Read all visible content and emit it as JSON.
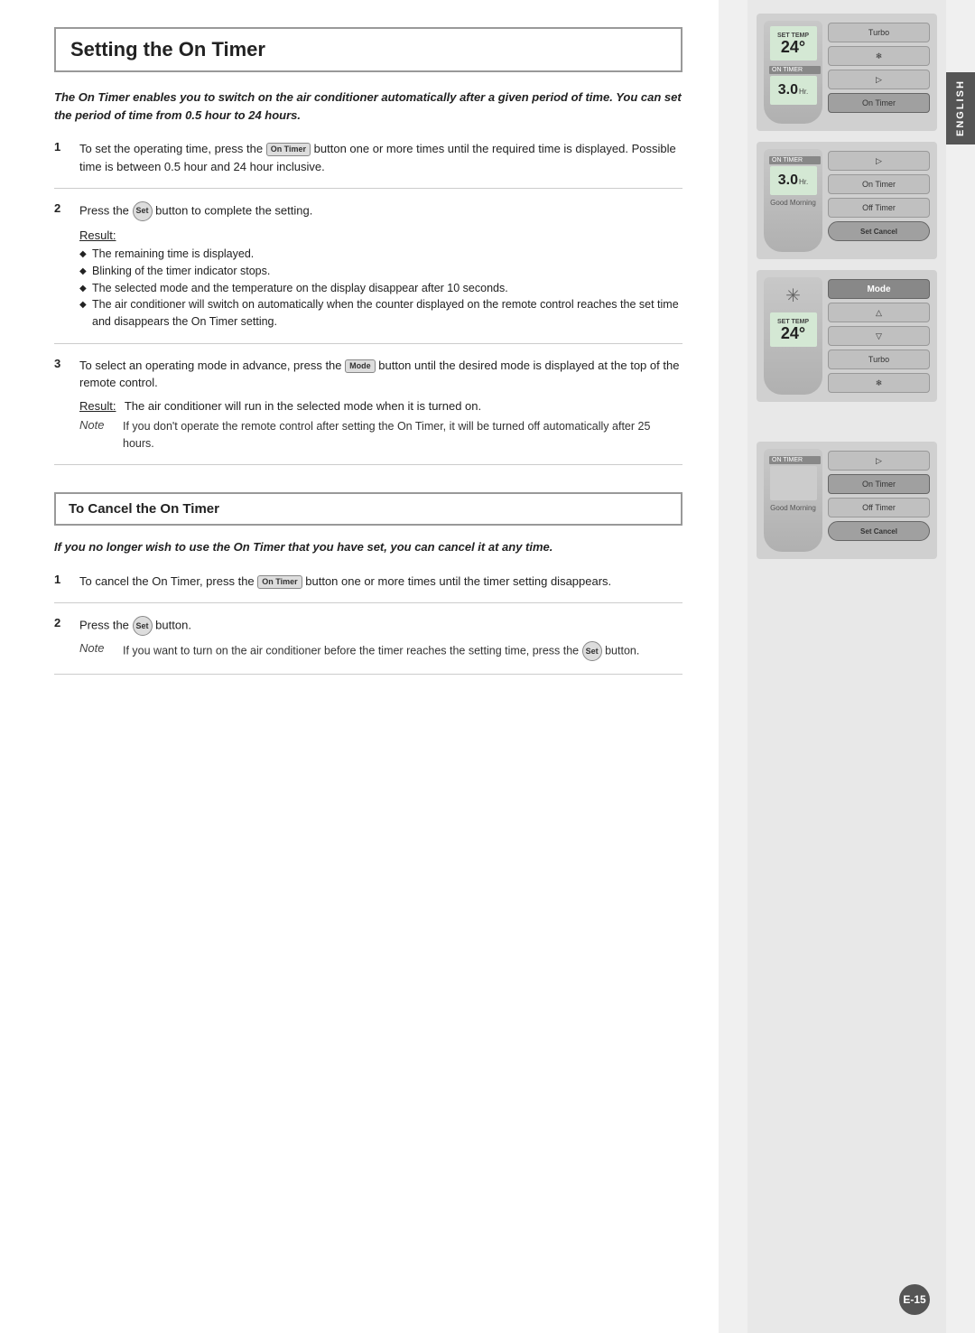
{
  "page": {
    "side_tab_label": "ENGLISH",
    "page_number": "E-15"
  },
  "section1": {
    "title": "Setting the On Timer",
    "intro": "The On Timer enables you to switch on the air conditioner automatically after a given period of time. You can set the period of time from 0.5 hour to 24 hours.",
    "step1_text": "To set the operating time, press the",
    "step1_btn": "On Timer",
    "step1_rest": "button one or more times until the required time is displayed. Possible time is between 0.5 hour and 24 hour inclusive.",
    "step2_text": "Press the",
    "step2_btn": "Set",
    "step2_rest": "button to complete the setting.",
    "result_label": "Result:",
    "result_items": [
      "The remaining time is displayed.",
      "Blinking of the timer indicator stops.",
      "The selected mode and the temperature on the display disappear after 10 seconds.",
      "The air conditioner will switch on automatically when the counter displayed on the remote control reaches the set time and disappears the On Timer setting."
    ],
    "step3_text": "To select an operating mode in advance, press the",
    "step3_btn": "Mode",
    "step3_rest": "button until the desired mode is displayed at the top of the remote control.",
    "result2_label": "Result:",
    "result2_text": "The air conditioner will run in the selected mode when it is turned on.",
    "note_label": "Note",
    "note_text": "If you don't operate the remote control after setting the On Timer, it will be turned off automatically after 25 hours."
  },
  "section2": {
    "title": "To Cancel the On Timer",
    "intro": "If you no longer wish to use the On Timer that you have set, you can cancel it at any time.",
    "step1_text": "To cancel the On Timer, press the",
    "step1_btn": "On Timer",
    "step1_rest": "button one or more times until the timer setting disappears.",
    "step2_text": "Press the",
    "step2_btn": "Set",
    "step2_rest": "button.",
    "note_label": "Note",
    "note_text": "If you want to turn on the air conditioner before the timer reaches the setting time, press the",
    "note_btn": "Set",
    "note_text2": "button."
  },
  "remotes": {
    "r1": {
      "set_temp": "SET TEMP",
      "temp": "24°",
      "on_timer": "ON TIMER",
      "timer": "3.0",
      "timer_unit": "Hr.",
      "btn_on_timer": "On Timer"
    },
    "r2": {
      "on_timer": "ON TIMER",
      "timer": "3.0",
      "timer_unit": "Hr.",
      "btn_on_timer": "On Timer",
      "btn_off_timer": "Off Timer",
      "btn_good_morning": "Good Morning",
      "btn_set_cancel": "Set Cancel"
    },
    "r3": {
      "mode_btn": "Mode",
      "set_temp": "SET TEMP",
      "temp": "24°",
      "btn_turbo": "Turbo"
    },
    "r4": {
      "on_timer": "ON TIMER",
      "btn_on_timer": "On Timer",
      "btn_off_timer": "Off Timer",
      "btn_good_morning": "Good Morning",
      "btn_set_cancel": "Set Cancel"
    }
  }
}
